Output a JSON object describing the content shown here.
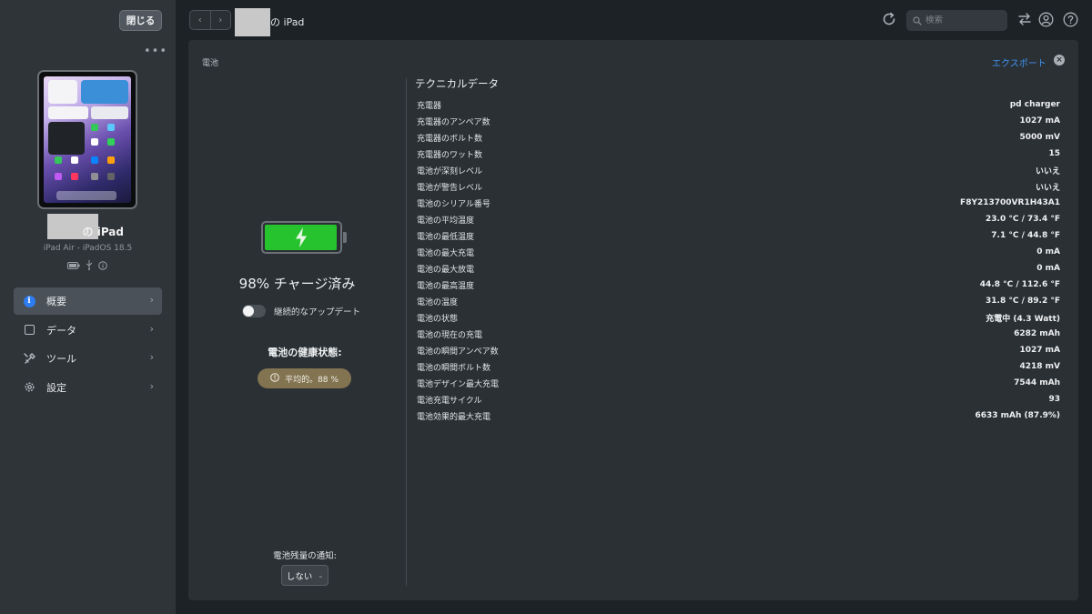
{
  "sidebar": {
    "close_label": "閉じる",
    "device_name": "の iPad",
    "device_model": "iPad Air - iPadOS 18.5",
    "nav": [
      {
        "label": "概要",
        "icon": "info-icon",
        "active": true
      },
      {
        "label": "データ",
        "icon": "data-icon",
        "active": false
      },
      {
        "label": "ツール",
        "icon": "tools-icon",
        "active": false
      },
      {
        "label": "設定",
        "icon": "gear-icon",
        "active": false
      }
    ]
  },
  "topbar": {
    "title": "の iPad",
    "search_placeholder": "検索"
  },
  "panel": {
    "section_label": "電池",
    "export_label": "エクスポート",
    "battery_percent": 98,
    "battery_color": "#27c32f",
    "charge_text": "98% チャージ済み",
    "toggle_label": "継続的なアップデート",
    "health_title": "電池の健康状態:",
    "health_badge": "平均的。88 %",
    "health_badge_color": "#827351",
    "notify_title": "電池残量の通知:",
    "notify_value": "しない",
    "tech_title": "テクニカルデータ",
    "tech_rows": [
      {
        "key": "充電器",
        "value": "pd charger"
      },
      {
        "key": "充電器のアンペア数",
        "value": "1027 mA"
      },
      {
        "key": "充電器のボルト数",
        "value": "5000 mV"
      },
      {
        "key": "充電器のワット数",
        "value": "15"
      },
      {
        "key": "電池が深刻レベル",
        "value": "いいえ"
      },
      {
        "key": "電池が警告レベル",
        "value": "いいえ"
      },
      {
        "key": "電池のシリアル番号",
        "value": "F8Y213700VR1H43A1"
      },
      {
        "key": "電池の平均温度",
        "value": "23.0 °C / 73.4 °F"
      },
      {
        "key": "電池の最低温度",
        "value": "7.1 °C / 44.8 °F"
      },
      {
        "key": "電池の最大充電",
        "value": "0 mA"
      },
      {
        "key": "電池の最大放電",
        "value": "0 mA"
      },
      {
        "key": "電池の最高温度",
        "value": "44.8 °C / 112.6 °F"
      },
      {
        "key": "電池の温度",
        "value": "31.8 °C / 89.2 °F"
      },
      {
        "key": "電池の状態",
        "value": "充電中 (4.3 Watt)"
      },
      {
        "key": "電池の現在の充電",
        "value": "6282 mAh"
      },
      {
        "key": "電池の瞬間アンペア数",
        "value": "1027 mA"
      },
      {
        "key": "電池の瞬間ボルト数",
        "value": "4218 mV"
      },
      {
        "key": "電池デザイン最大充電",
        "value": "7544 mAh"
      },
      {
        "key": "電池充電サイクル",
        "value": "93"
      },
      {
        "key": "電池効果的最大充電",
        "value": "6633 mAh (87.9%)"
      }
    ]
  }
}
